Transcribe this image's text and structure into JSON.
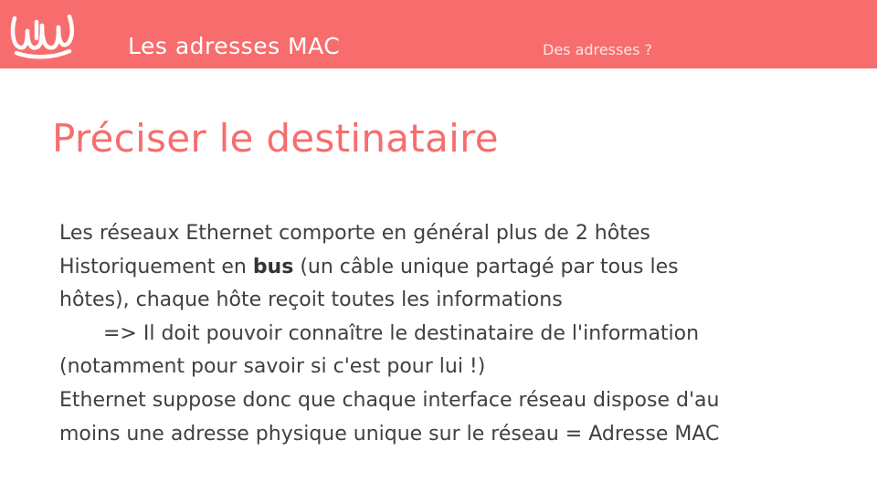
{
  "colors": {
    "accent": "#f76d6d",
    "header_text": "#ffffff",
    "subsection_text": "#ffe3e3",
    "body_text": "#404040"
  },
  "header": {
    "logo_icon": "wave-logo-icon",
    "section_title": "Les adresses MAC",
    "subsection_title": "Des adresses ?"
  },
  "slide": {
    "title": "Préciser le destinataire",
    "paragraphs": {
      "p1": "Les réseaux Ethernet comporte en général plus de 2 hôtes",
      "p2_before": "Historiquement en ",
      "p2_bold": "bus",
      "p2_after": " (un câble unique partagé par tous les",
      "p3": "hôtes), chaque hôte reçoit toutes les informations",
      "p4": "=> Il doit pouvoir connaître le destinataire de l'information",
      "p5": "(notamment pour savoir si c'est pour lui !)",
      "p6": "Ethernet suppose donc que chaque interface réseau dispose d'au",
      "p7": "moins une adresse physique unique sur le réseau = Adresse MAC"
    }
  }
}
